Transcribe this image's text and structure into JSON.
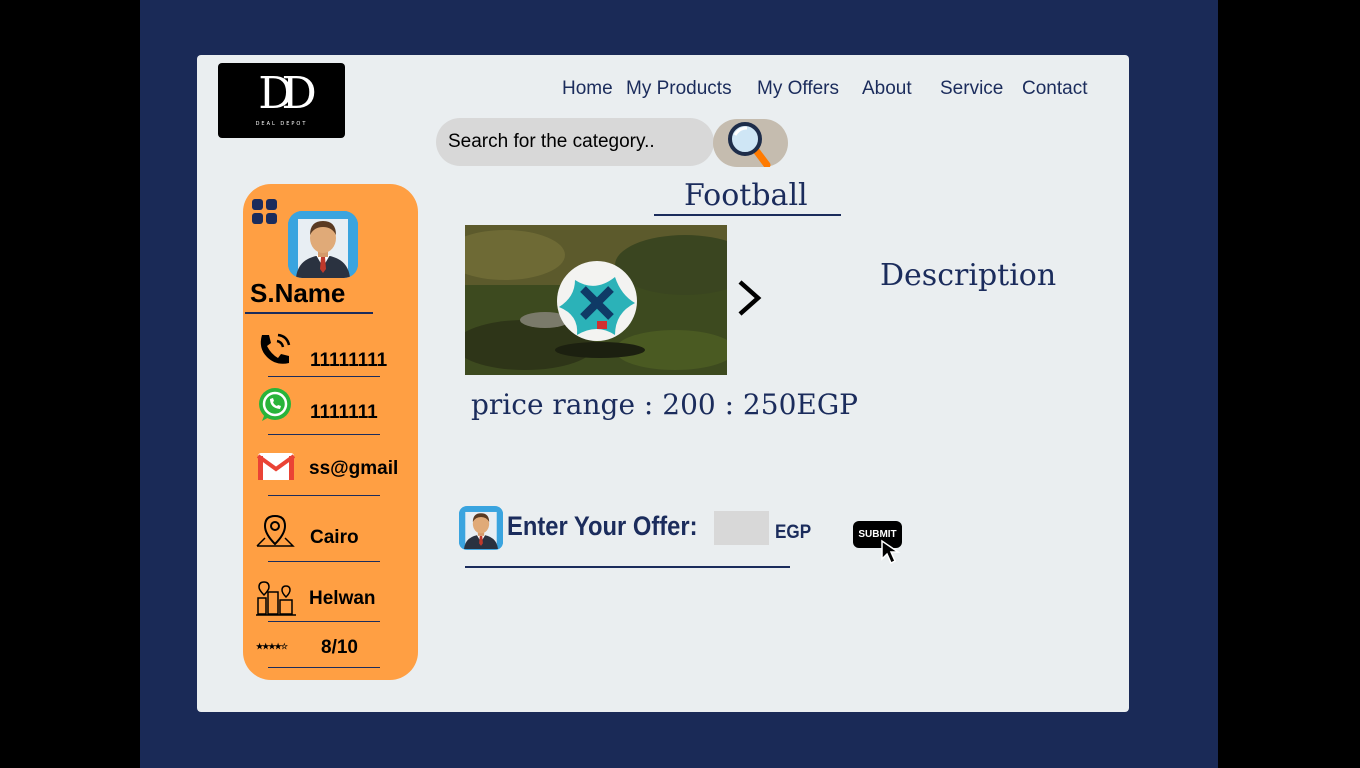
{
  "logo": {
    "mark": "DD",
    "tagline": "DEAL DEPOT"
  },
  "nav": {
    "items": [
      "Home",
      "My Products",
      "My Offers",
      "About",
      "Service",
      "Contact"
    ]
  },
  "search": {
    "placeholder": "Search for the category.."
  },
  "profile": {
    "name": "S.Name",
    "phone": "11111111",
    "whatsapp": "1111111",
    "email": "ss@gmail",
    "city": "Cairo",
    "district": "Helwan",
    "rating": "8/10",
    "stars": "★★★★☆"
  },
  "product": {
    "title": "Football",
    "description_label": "Description",
    "price_range": "price range : 200 : 250EGP"
  },
  "offer": {
    "label": "Enter Your Offer:",
    "value": "",
    "currency": "EGP",
    "submit_label": "SUBMIT"
  },
  "colors": {
    "frame": "#1a2a57",
    "card": "#eaeef0",
    "profile": "#ff9f43",
    "text": "#1b2c5c"
  },
  "icons": [
    "grid-icon",
    "avatar-icon",
    "phone-icon",
    "whatsapp-icon",
    "gmail-icon",
    "location-pin-icon",
    "city-icon",
    "star-rating-icon",
    "magnifier-icon",
    "chevron-right-icon",
    "pointer-cursor-icon"
  ]
}
